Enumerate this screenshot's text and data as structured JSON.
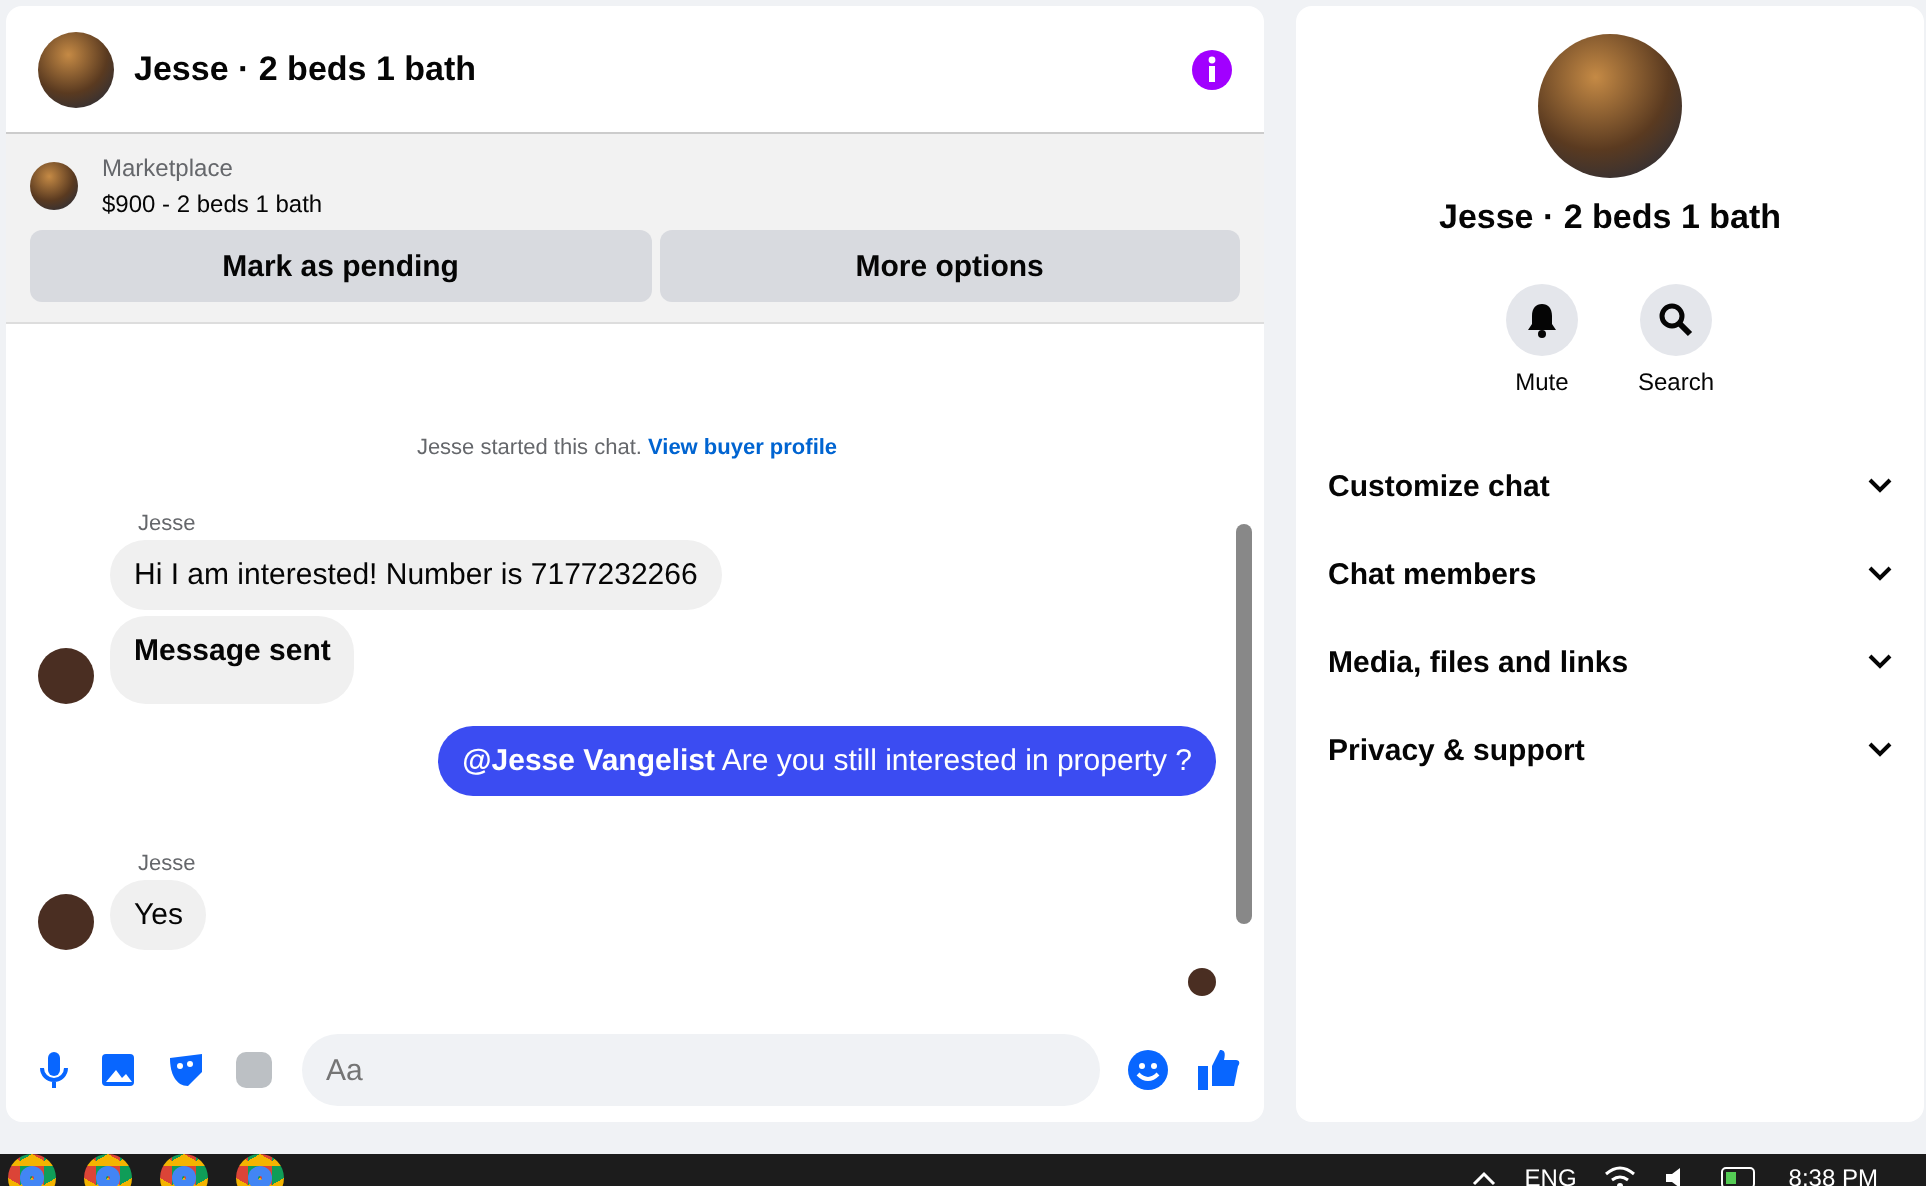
{
  "chat": {
    "title": "Jesse · 2 beds 1 bath",
    "listing": {
      "source": "Marketplace",
      "summary": "$900 - 2 beds 1 bath"
    },
    "actions": [
      "Mark as pending",
      "More options"
    ],
    "notice": {
      "text": "Jesse started this chat.",
      "link": "View buyer profile"
    },
    "messages": [
      {
        "kind": "sender",
        "text": "Jesse"
      },
      {
        "kind": "incoming",
        "text": "Hi I am interested! Number is 7177232266",
        "avatar": false,
        "bold": false
      },
      {
        "kind": "incoming",
        "text": "Message sent",
        "avatar": true,
        "bold": true
      },
      {
        "kind": "outgoing",
        "text": "**@Jesse Vangelist** Are you still interested in property ?"
      },
      {
        "kind": "sender",
        "text": "Jesse"
      },
      {
        "kind": "incoming",
        "text": "Yes",
        "avatar": true,
        "bold": false
      }
    ],
    "composer": {
      "placeholder": "Aa"
    }
  },
  "details": {
    "title": "Jesse · 2 beds 1 bath",
    "actions": [
      {
        "kind": "mute",
        "label": "Mute"
      },
      {
        "kind": "search",
        "label": "Search"
      }
    ],
    "sections": [
      {
        "label": "Customize chat",
        "expanded": false
      },
      {
        "label": "Chat members",
        "expanded": false
      },
      {
        "label": "Media, files and links",
        "expanded": false
      },
      {
        "label": "Privacy & support",
        "expanded": false
      }
    ]
  },
  "taskbar": {
    "language": "ENG",
    "time": "8:38 PM"
  }
}
